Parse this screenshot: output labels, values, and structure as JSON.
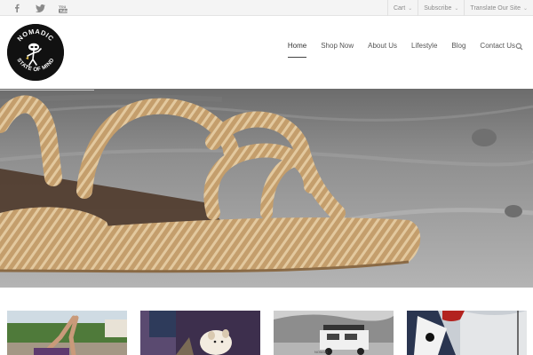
{
  "social": [
    {
      "name": "facebook-icon",
      "glyph": "f"
    },
    {
      "name": "twitter-icon",
      "glyph": "t"
    },
    {
      "name": "youtube-icon",
      "glyph": "yt"
    }
  ],
  "utility": {
    "cart": "Cart",
    "subscribe": "Subscribe",
    "translate": "Translate Our Site"
  },
  "logo": {
    "top_text": "NOMADIC",
    "bottom_text": "STATE OF MIND"
  },
  "nav": {
    "items": [
      "Home",
      "Shop Now",
      "About Us",
      "Lifestyle",
      "Blog",
      "Contact Us"
    ],
    "active": "Home"
  },
  "colors": {
    "accent": "#333333",
    "topbar": "#f4f4f4",
    "logo_bg": "#111111"
  },
  "gallery": [
    {
      "name": "thumb-beach-yoga"
    },
    {
      "name": "thumb-dog"
    },
    {
      "name": "thumb-land-rover"
    },
    {
      "name": "thumb-flags"
    }
  ]
}
